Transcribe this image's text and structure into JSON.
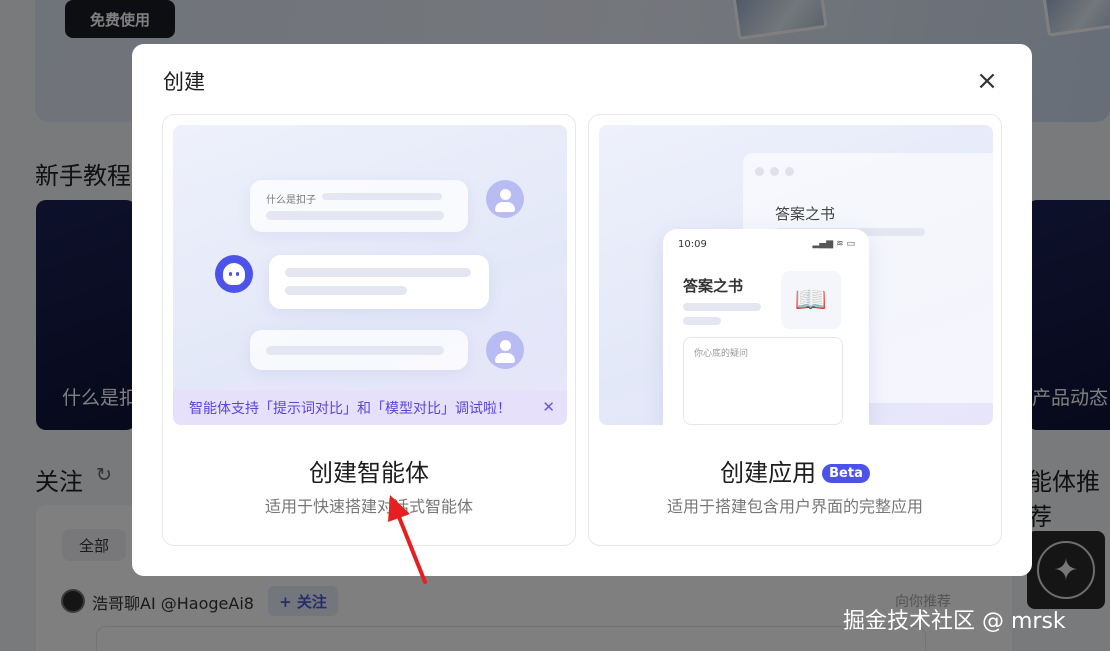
{
  "background": {
    "free_button": "免费使用",
    "tutorial_section": "新手教程",
    "tutorial_card_left": "什么是扣",
    "tutorial_card_right": "产品动态",
    "follow_section": "关注",
    "right_section": "能体推荐",
    "tabs": {
      "all": "全部"
    },
    "post": {
      "author": "浩哥聊AI @HaogeAi8",
      "follow_button": "+ 关注",
      "recommend": "向你推荐"
    }
  },
  "modal": {
    "title": "创建",
    "close_icon": "×",
    "options": [
      {
        "title": "创建智能体",
        "desc": "适用于快速搭建对话式智能体",
        "preview": {
          "question": "什么是扣子",
          "notice": "智能体支持「提示词对比」和「模型对比」调试啦！",
          "notice_close": "✕"
        }
      },
      {
        "title": "创建应用",
        "badge": "Beta",
        "desc": "适用于搭建包含用户界面的完整应用",
        "preview": {
          "window_title": "答案之书",
          "time": "10:09",
          "status": "▂▄▆ ≋ ▭",
          "phone_title": "答案之书",
          "book_icon": "📖",
          "input_placeholder": "你心底的疑问"
        }
      }
    ]
  },
  "watermark": "掘金技术社区 @ mrsk"
}
